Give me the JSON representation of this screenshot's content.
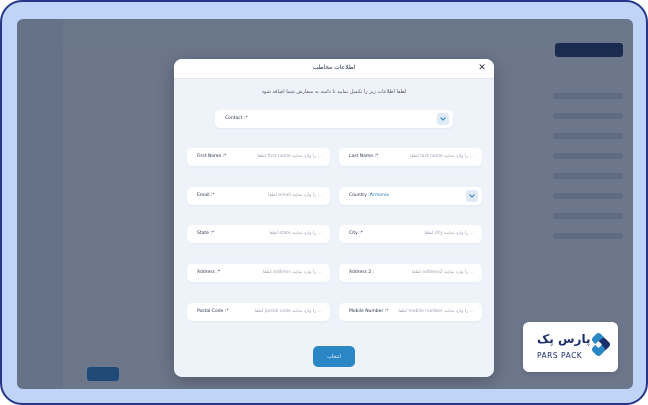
{
  "modal": {
    "title": "اطلاعات مخاطب",
    "subtitle": "لطفا اطلاعات زیر را تکمیل نمایید تا دامنه به سفارش شما اضافه شود",
    "submit_label": "انتخاب"
  },
  "contact": {
    "label": "Contact :*"
  },
  "fields": {
    "first_name": {
      "label": "First Name :*",
      "placeholder": "لطفا first name را وارد نمایید ..."
    },
    "last_name": {
      "label": "Last Name :*",
      "placeholder": "لطفا last name را وارد نمایید ..."
    },
    "email": {
      "label": "Email :*",
      "placeholder": "لطفا email را وارد نمایید ..."
    },
    "country": {
      "label": "Country :*",
      "value": "Armenia"
    },
    "state": {
      "label": "State :*",
      "placeholder": "لطفا state را وارد نمایید ..."
    },
    "city": {
      "label": "City :*",
      "placeholder": "لطفا city را وارد نمایید ..."
    },
    "address": {
      "label": "Address :*",
      "placeholder": "لطفا address را وارد نمایید ..."
    },
    "address2": {
      "label": "Address 2 :",
      "placeholder": "لطفا address2 را وارد نمایید ..."
    },
    "postal_code": {
      "label": "Postal Code :*",
      "placeholder": "لطفا postal code را وارد نمایید ..."
    },
    "mobile_number": {
      "label": "Mobile Number :*",
      "placeholder": "لطفا mobile number را وارد نمایید ..."
    }
  },
  "logo": {
    "text_fa": "پارس پک",
    "text_en": "PARS PACK"
  },
  "icons": {
    "close": "close-icon",
    "chevron": "chevron-down-icon",
    "logo": "parspack-logo-icon"
  },
  "colors": {
    "accent": "#2a86c4",
    "brand": "#1b2e6b",
    "frame": "#bfd4f6",
    "frame_border": "#27368a"
  }
}
